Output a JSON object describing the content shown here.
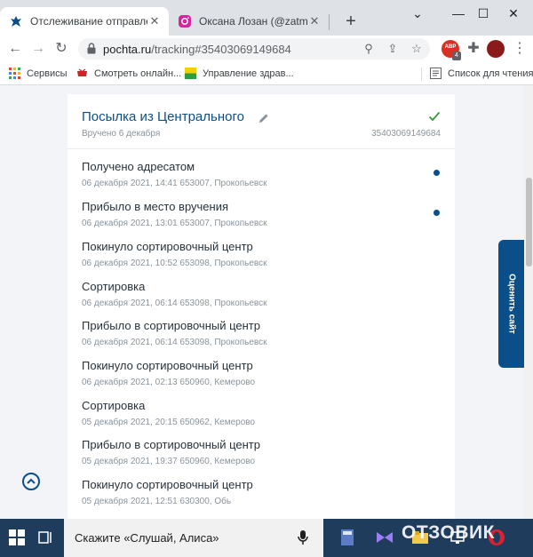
{
  "browser": {
    "tabs": [
      {
        "title": "Отслеживание отправлений",
        "active": true
      },
      {
        "title": "Оксана Лозан (@zatmenie.l",
        "active": false
      }
    ],
    "url_host": "pochta.ru",
    "url_path": "/tracking#35403069149684",
    "extension_badge": "ABP",
    "extension_count": "4",
    "bookmarks": [
      {
        "label": "Сервисы",
        "icon": "apps-grid-icon"
      },
      {
        "label": "Смотреть онлайн...",
        "icon": "film-icon"
      },
      {
        "label": "Управление здрав...",
        "icon": "health-icon"
      }
    ],
    "reading_list": "Список для чтения"
  },
  "parcel": {
    "title": "Посылка из Центрального",
    "status": "Вручено 6 декабря",
    "tracking_number": "35403069149684"
  },
  "events": [
    {
      "status": "Получено адресатом",
      "details": "06 декабря 2021, 14:41 653007, Прокопьевск",
      "dot": true
    },
    {
      "status": "Прибыло в место вручения",
      "details": "06 декабря 2021, 13:01 653007, Прокопьевск",
      "dot": true
    },
    {
      "status": "Покинуло сортировочный центр",
      "details": "06 декабря 2021, 10:52 653098, Прокопьевск",
      "dot": false
    },
    {
      "status": "Сортировка",
      "details": "06 декабря 2021, 06:14 653098, Прокопьевск",
      "dot": false
    },
    {
      "status": "Прибыло в сортировочный центр",
      "details": "06 декабря 2021, 06:14 653098, Прокопьевск",
      "dot": false
    },
    {
      "status": "Покинуло сортировочный центр",
      "details": "06 декабря 2021, 02:13 650960, Кемерово",
      "dot": false
    },
    {
      "status": "Сортировка",
      "details": "05 декабря 2021, 20:15 650962, Кемерово",
      "dot": false
    },
    {
      "status": "Прибыло в сортировочный центр",
      "details": "05 декабря 2021, 19:37 650960, Кемерово",
      "dot": false
    },
    {
      "status": "Покинуло сортировочный центр",
      "details": "05 декабря 2021, 12:51 630300, Обь",
      "dot": false
    }
  ],
  "rate_site": "Оценить сайт",
  "taskbar": {
    "search_text": "Скажите «Слушай, Алиса»"
  },
  "watermark": "ОТЗОВИК",
  "colors": {
    "brand_blue": "#0b4f8a",
    "accent_green": "#3a9b3e",
    "taskbar": "#1f3c5c"
  }
}
